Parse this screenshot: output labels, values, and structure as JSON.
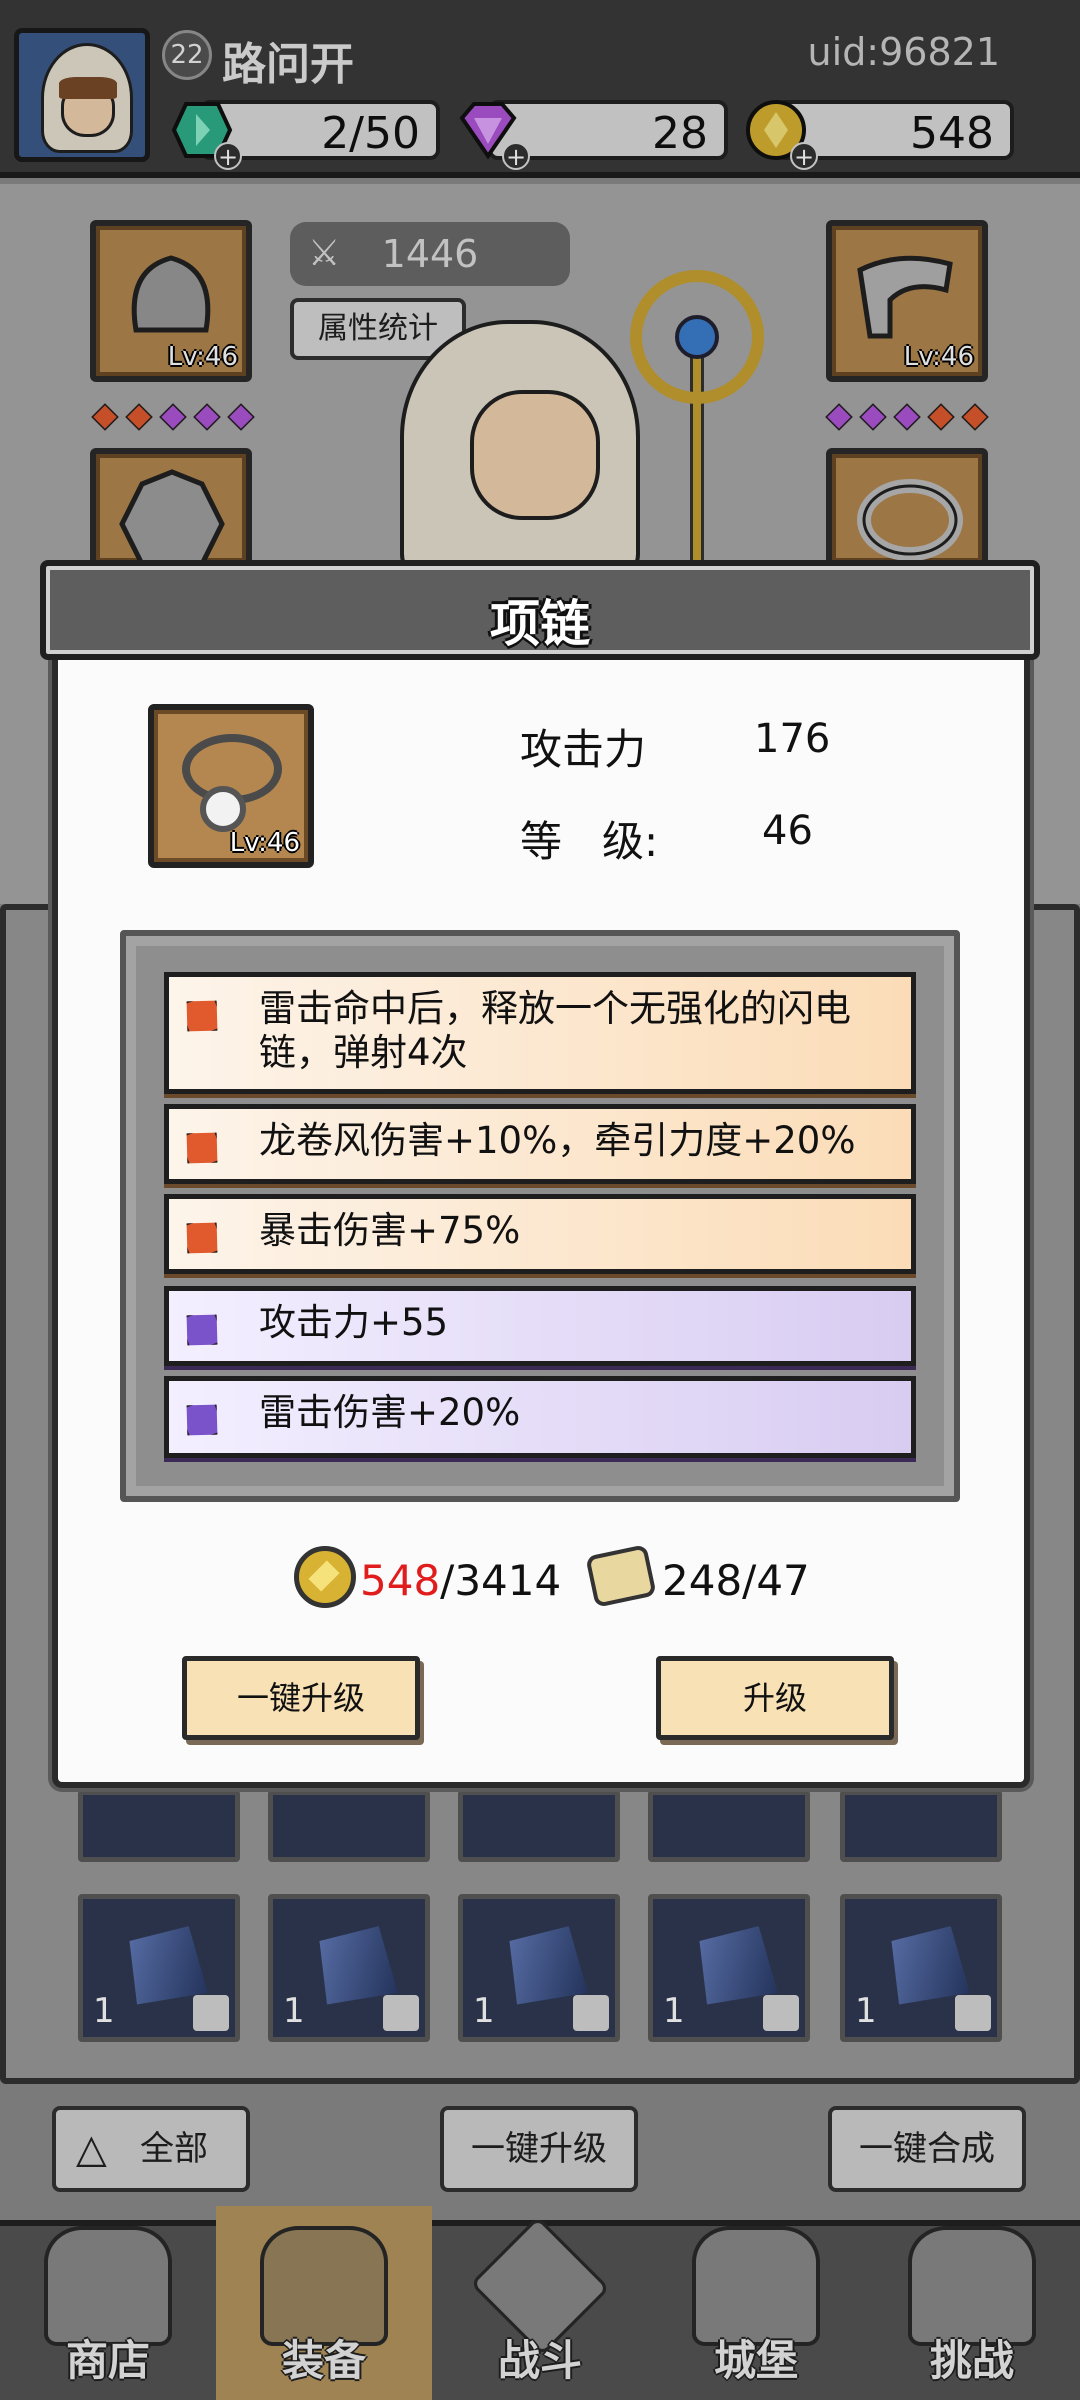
{
  "player": {
    "level": "22",
    "name": "路问开",
    "uid": "uid:96821"
  },
  "resources": {
    "energy": "2/50",
    "gems": "28",
    "gold": "548"
  },
  "character": {
    "power": "1446",
    "stats_button": "属性统计",
    "slots": {
      "helmet_lv": "Lv:46",
      "gloves_lv": "Lv:46"
    }
  },
  "modal": {
    "title": "项链",
    "item_lv": "Lv:46",
    "attack_label": "攻击力",
    "attack_value": "176",
    "level_label": "等   级:",
    "level_value": "46",
    "affixes": [
      {
        "text": "雷击命中后，释放一个无强化的闪电链，弹射4次",
        "rarity": "orange"
      },
      {
        "text": "龙卷风伤害+10%，牵引力度+20%",
        "rarity": "orange"
      },
      {
        "text": "暴击伤害+75%",
        "rarity": "orange"
      },
      {
        "text": "攻击力+55",
        "rarity": "purple"
      },
      {
        "text": "雷击伤害+20%",
        "rarity": "purple"
      }
    ],
    "cost": {
      "gold_have": "548",
      "gold_need": "/3414",
      "scroll": "248/47"
    },
    "buttons": {
      "auto_upgrade": "一键升级",
      "upgrade": "升级"
    }
  },
  "inventory": {
    "row2_qty": [
      "1",
      "1",
      "1",
      "1",
      "1"
    ]
  },
  "bottom_actions": {
    "filter": "全部",
    "auto_upgrade": "一键升级",
    "auto_merge": "一键合成"
  },
  "nav": {
    "shop": "商店",
    "equipment": "装备",
    "battle": "战斗",
    "castle": "城堡",
    "challenge": "挑战"
  },
  "colors": {
    "rarity_orange": "#e05a2e",
    "rarity_purple": "#7a52c9",
    "cost_insufficient": "#e01c1c"
  }
}
